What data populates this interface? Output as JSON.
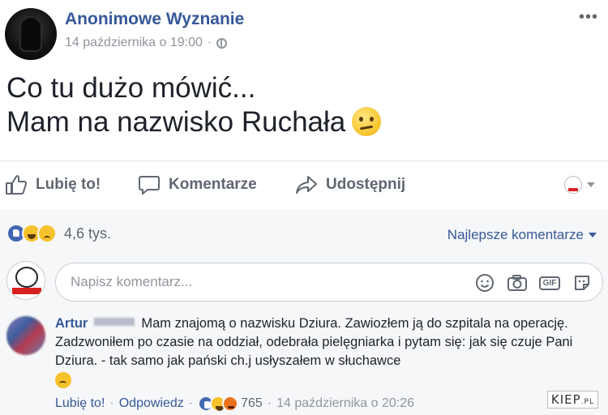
{
  "post": {
    "author": "Anonimowe Wyznanie",
    "timestamp": "14 października o 19:00",
    "text_lines": [
      "Co tu dużo mówić...",
      "Mam na nazwisko Ruchała"
    ],
    "emoji": "confused-face-icon"
  },
  "actions": {
    "like": "Lubię to!",
    "comment": "Komentarze",
    "share": "Udostępnij"
  },
  "reactions": {
    "icons": [
      "like",
      "haha",
      "sad"
    ],
    "count": "4,6 tys."
  },
  "comments_sort": "Najlepsze komentarze",
  "composer": {
    "placeholder": "Napisz komentarz..."
  },
  "comment": {
    "author": "Artur",
    "text": "Mam znajomą o nazwisku Dziura. Zawiozłem ją do szpitala na operację. Zadzwoniłem po czasie na oddział, odebrała pielęgniarka i pytam się: jak się czuje Pani Dziura. - tak samo jak pański ch.j usłyszałem w słuchawce",
    "like_label": "Lubię to!",
    "reply_label": "Odpowiedz",
    "reactions": [
      "like",
      "haha",
      "angry"
    ],
    "reaction_count": "765",
    "timestamp": "14 października o 20:26"
  },
  "watermark": {
    "main": "KIEP",
    "suffix": ".PL"
  },
  "colors": {
    "link": "#365899",
    "muted": "#90949c",
    "text": "#1d2129"
  }
}
